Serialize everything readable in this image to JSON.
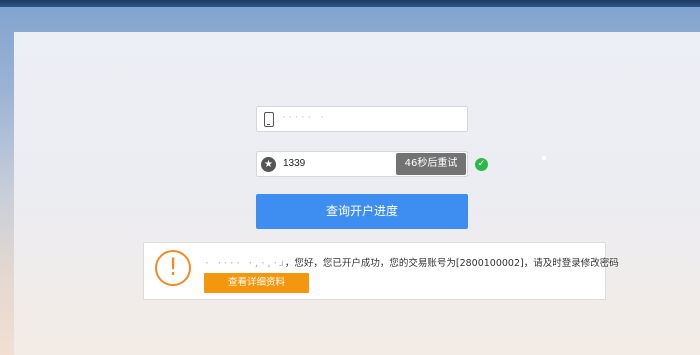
{
  "form": {
    "phone_masked": "····· ·",
    "code_value": "1339",
    "retry_label": "46秒后重试",
    "query_label": "查询开户进度"
  },
  "result": {
    "account_masked": "· ···· ·,·,·ɹ",
    "message": "，您好，您已开户成功，您的交易账号为[2800100002]，请及时登录修改密码",
    "detail_label": "查看详细资料"
  },
  "colors": {
    "primary_button": "#3d8ef0",
    "retry_button": "#737373",
    "detail_button": "#f3980e",
    "warning": "#f08a2a",
    "success": "#2db84a"
  },
  "icons": {
    "phone": "phone-icon",
    "code": "star-icon",
    "valid": "check-icon",
    "result": "exclamation-icon"
  }
}
